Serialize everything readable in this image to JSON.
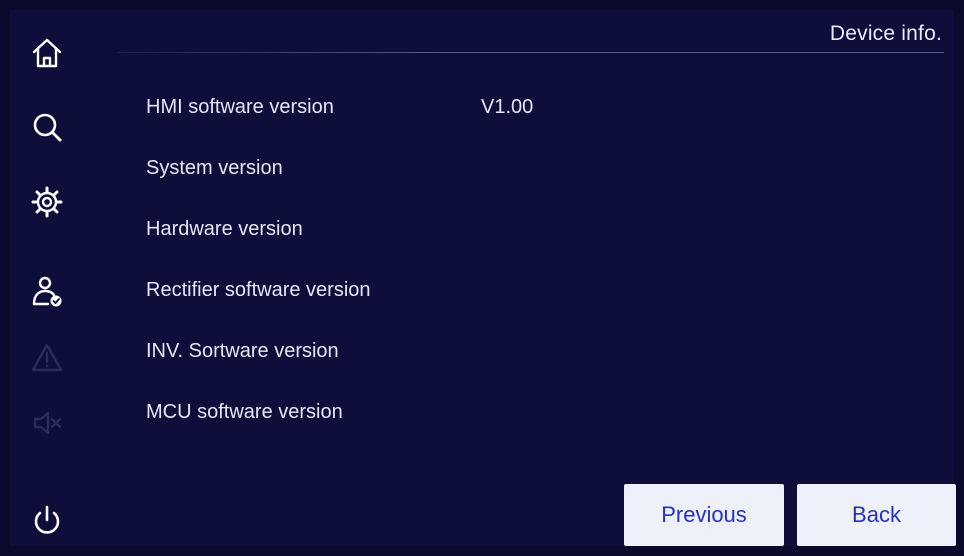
{
  "header": {
    "title": "Device info."
  },
  "sidebar": {
    "items": [
      {
        "icon": "home-icon",
        "state": "enabled"
      },
      {
        "icon": "search-icon",
        "state": "enabled"
      },
      {
        "icon": "settings-gear-icon",
        "state": "enabled"
      },
      {
        "icon": "user-check-icon",
        "state": "enabled"
      },
      {
        "icon": "alarm-warning-icon",
        "state": "disabled"
      },
      {
        "icon": "buzzer-mute-icon",
        "state": "disabled"
      },
      {
        "icon": "power-icon",
        "state": "enabled"
      }
    ]
  },
  "device_info": {
    "rows": [
      {
        "label": "HMI software version",
        "value": "V1.00"
      },
      {
        "label": "System version",
        "value": ""
      },
      {
        "label": "Hardware version",
        "value": ""
      },
      {
        "label": "Rectifier software version",
        "value": ""
      },
      {
        "label": "INV. Sortware version",
        "value": ""
      },
      {
        "label": "MCU software version",
        "value": ""
      }
    ]
  },
  "buttons": {
    "previous_label": "Previous",
    "back_label": "Back"
  },
  "colors": {
    "background": "#0d0e3a",
    "text": "#e4e7f3",
    "button_bg": "#eef1fa",
    "button_text": "#2432c2",
    "icon_enabled": "#ffffff",
    "icon_disabled": "#2a2c5e"
  }
}
